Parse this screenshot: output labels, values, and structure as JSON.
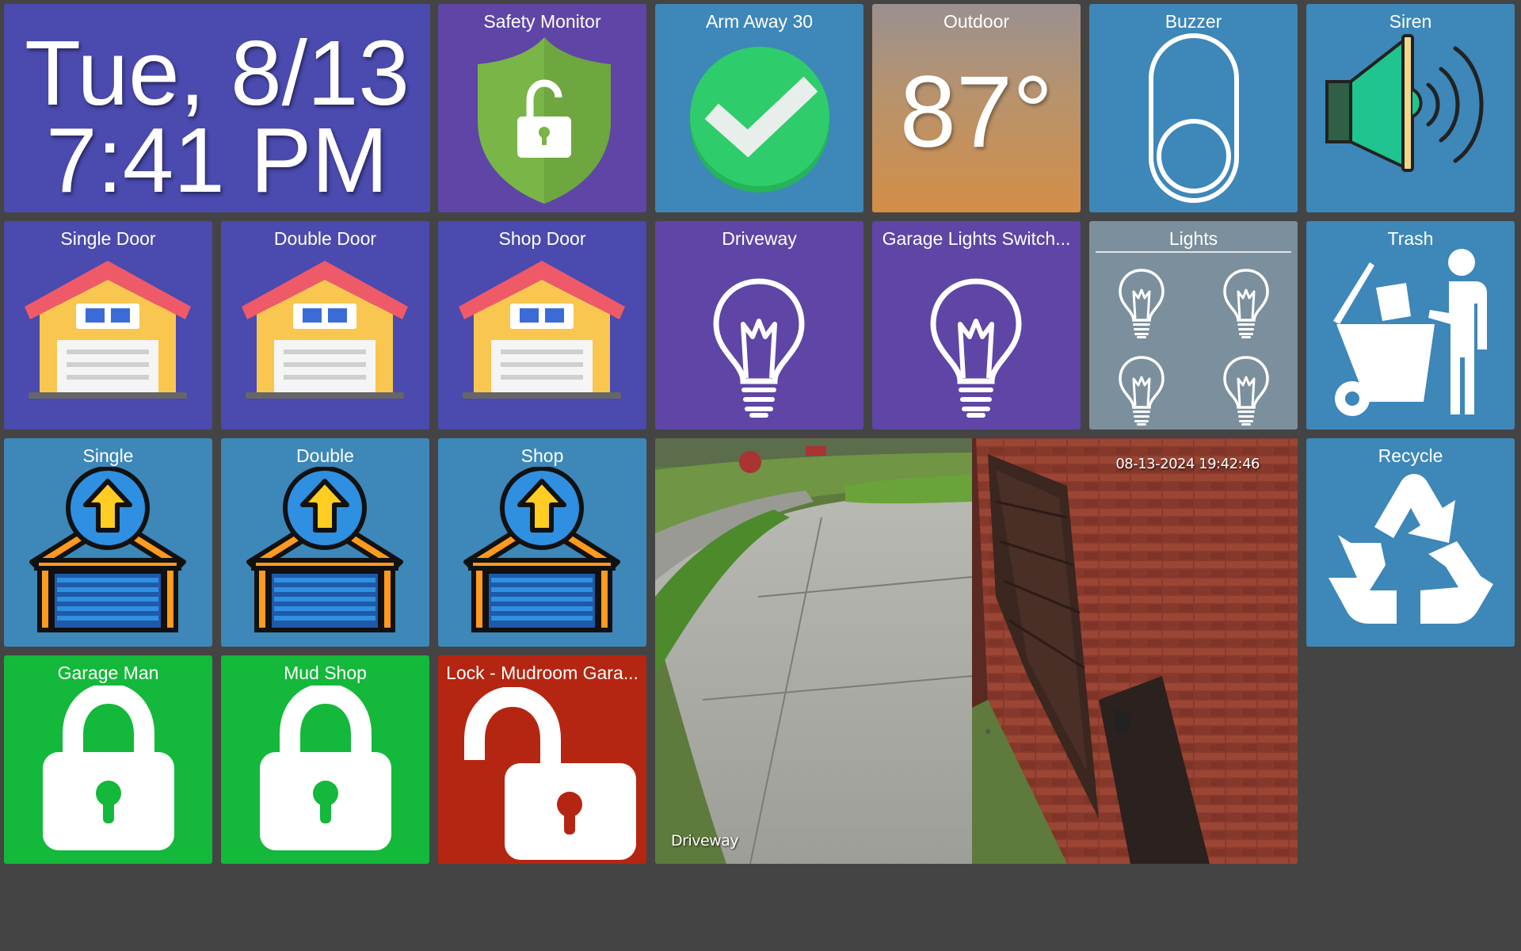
{
  "clock": {
    "date": "Tue, 8/13",
    "time": "7:41 PM"
  },
  "tiles": {
    "safety_monitor": {
      "title": "Safety Monitor",
      "icon": "shield-unlocked-icon",
      "color": "#5e45a6"
    },
    "arm_away": {
      "title": "Arm Away 30",
      "icon": "green-check-icon",
      "color": "#3d87b9"
    },
    "outdoor": {
      "title": "Outdoor",
      "value": "87°"
    },
    "buzzer": {
      "title": "Buzzer",
      "icon": "toggle-off-icon",
      "color": "#3d87b9"
    },
    "siren": {
      "title": "Siren",
      "icon": "speaker-icon",
      "color": "#3d87b9"
    },
    "single_door": {
      "title": "Single Door",
      "icon": "garage-house-icon"
    },
    "double_door": {
      "title": "Double Door",
      "icon": "garage-house-icon"
    },
    "shop_door": {
      "title": "Shop Door",
      "icon": "garage-house-icon"
    },
    "driveway": {
      "title": "Driveway",
      "icon": "lightbulb-icon"
    },
    "garage_lights": {
      "title": "Garage Lights Switch...",
      "icon": "lightbulb-icon"
    },
    "lights": {
      "title": "Lights",
      "icon": "lightbulb-group-icon"
    },
    "trash": {
      "title": "Trash",
      "icon": "trash-person-icon"
    },
    "single": {
      "title": "Single",
      "icon": "garage-open-icon"
    },
    "double": {
      "title": "Double",
      "icon": "garage-open-icon"
    },
    "shop": {
      "title": "Shop",
      "icon": "garage-open-icon"
    },
    "recycle": {
      "title": "Recycle",
      "icon": "recycle-icon"
    },
    "garage_man": {
      "title": "Garage Man",
      "icon": "lock-locked-icon",
      "state": "locked"
    },
    "mud_shop": {
      "title": "Mud Shop",
      "icon": "lock-locked-icon",
      "state": "locked"
    },
    "lock_mudroom": {
      "title": "Lock - Mudroom Gara...",
      "icon": "lock-unlocked-icon",
      "state": "unlocked"
    }
  },
  "camera": {
    "timestamp": "08-13-2024 19:42:46",
    "label": "Driveway"
  },
  "colors": {
    "background": "#444444",
    "purple": "#5e45a6",
    "indigo": "#4a4aaf",
    "blue": "#3d87b9",
    "green": "#14b83a",
    "red": "#b42611",
    "slate": "#7b8f9c"
  }
}
